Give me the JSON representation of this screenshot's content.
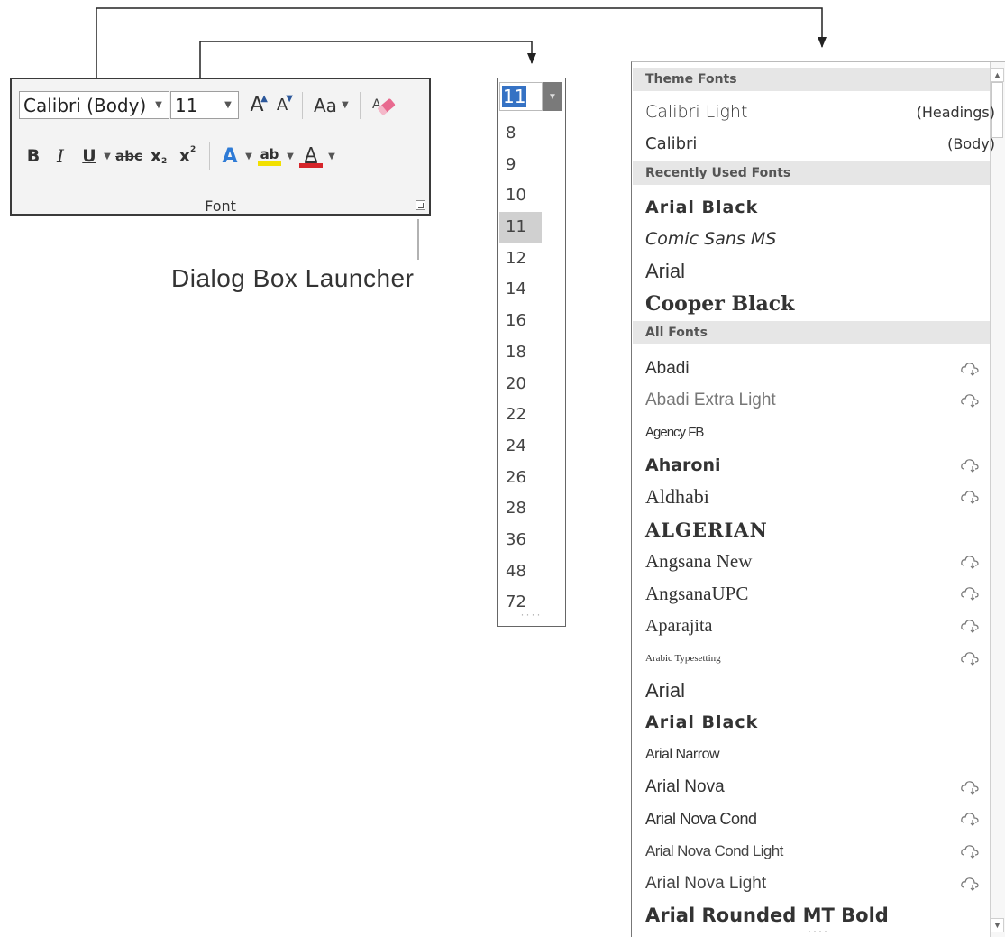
{
  "font_group": {
    "font_name": "Calibri (Body)",
    "font_size": "11",
    "grow_font_label": "A",
    "shrink_font_label": "A",
    "change_case_label": "Aa",
    "bold_label": "B",
    "italic_label": "I",
    "underline_label": "U",
    "strikethrough_label": "abc",
    "subscript_label": "x",
    "subscript_mark": "2",
    "superscript_label": "x",
    "superscript_mark": "2",
    "text_effects_label": "A",
    "highlight_label": "ab",
    "font_color_label": "A",
    "group_label": "Font",
    "highlight_color": "#f2e000",
    "font_color": "#d6252a"
  },
  "callout": {
    "dialog_box_launcher": "Dialog Box Launcher"
  },
  "size_dropdown": {
    "current": "11",
    "selected": "11",
    "sizes": [
      "8",
      "9",
      "10",
      "11",
      "12",
      "14",
      "16",
      "18",
      "20",
      "22",
      "24",
      "26",
      "28",
      "36",
      "48",
      "72"
    ]
  },
  "font_list": {
    "sections": {
      "theme": "Theme Fonts",
      "recent": "Recently Used Fonts",
      "all": "All Fonts"
    },
    "theme_fonts": [
      {
        "name": "Calibri Light",
        "tag": "(Headings)"
      },
      {
        "name": "Calibri",
        "tag": "(Body)"
      }
    ],
    "recent_fonts": [
      {
        "name": "Arial Black"
      },
      {
        "name": "Comic Sans MS"
      },
      {
        "name": "Arial"
      },
      {
        "name": "Cooper Black"
      }
    ],
    "all_fonts": [
      {
        "name": "Abadi",
        "cloud": true
      },
      {
        "name": "Abadi Extra Light",
        "cloud": true
      },
      {
        "name": "Agency FB",
        "cloud": false
      },
      {
        "name": "Aharoni",
        "cloud": true
      },
      {
        "name": "Aldhabi",
        "cloud": true
      },
      {
        "name": "ALGERIAN",
        "cloud": false
      },
      {
        "name": "Angsana New",
        "cloud": true
      },
      {
        "name": "AngsanaUPC",
        "cloud": true
      },
      {
        "name": "Aparajita",
        "cloud": true
      },
      {
        "name": "Arabic Typesetting",
        "cloud": true
      },
      {
        "name": "Arial",
        "cloud": false
      },
      {
        "name": "Arial Black",
        "cloud": false
      },
      {
        "name": "Arial Narrow",
        "cloud": false
      },
      {
        "name": "Arial Nova",
        "cloud": true
      },
      {
        "name": "Arial Nova Cond",
        "cloud": true
      },
      {
        "name": "Arial Nova Cond Light",
        "cloud": true
      },
      {
        "name": "Arial Nova Light",
        "cloud": true
      },
      {
        "name": "Arial Rounded MT Bold",
        "cloud": false
      }
    ]
  }
}
